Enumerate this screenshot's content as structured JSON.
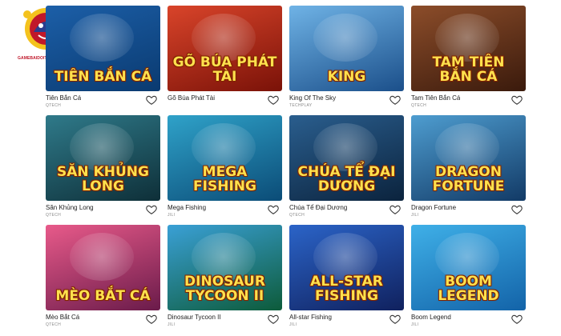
{
  "site": {
    "logo_text": "GAMEBAIDOITHUONG • VIETNAM",
    "accent": "#c0182a"
  },
  "games": [
    {
      "name": "Tiên Bắn Cá",
      "provider": "QTECH",
      "art": "TIÊN BẮN CÁ",
      "bg": [
        "#1c5fa8",
        "#0a3a70"
      ]
    },
    {
      "name": "Gõ Búa Phát Tài",
      "provider": "",
      "art": "GÕ BÚA PHÁT TÀI",
      "bg": [
        "#d9442a",
        "#7a1208"
      ]
    },
    {
      "name": "King Of The Sky",
      "provider": "TECHPLAY",
      "art": "KING",
      "bg": [
        "#6fb3e6",
        "#1b4f8a"
      ]
    },
    {
      "name": "Tam Tiên Bắn Cá",
      "provider": "QTECH",
      "art": "TAM TIÊN BẮN CÁ",
      "bg": [
        "#8c4d2a",
        "#3a1a0c"
      ]
    },
    {
      "name": "Săn Khủng Long",
      "provider": "QTECH",
      "art": "SĂN KHỦNG LONG",
      "bg": [
        "#2f7a8a",
        "#0e2f38"
      ]
    },
    {
      "name": "Mega Fishing",
      "provider": "JILI",
      "art": "Mega Fishing",
      "bg": [
        "#2fa2c9",
        "#0b4c77"
      ]
    },
    {
      "name": "Chúa Tể Đại Dương",
      "provider": "QTECH",
      "art": "CHÚA TỂ ĐẠI DƯƠNG",
      "bg": [
        "#2a5e8e",
        "#0b233d"
      ]
    },
    {
      "name": "Dragon Fortune",
      "provider": "JILI",
      "art": "Dragon Fortune",
      "bg": [
        "#4e9dd0",
        "#123a66"
      ]
    },
    {
      "name": "Mèo Bắt Cá",
      "provider": "QTECH",
      "art": "MÈO BẮT CÁ",
      "bg": [
        "#e85a8a",
        "#6a1b4a"
      ]
    },
    {
      "name": "Dinosaur Tycoon II",
      "provider": "JILI",
      "art": "Dinosaur Tycoon II",
      "bg": [
        "#3aa0d6",
        "#0d5b3a"
      ]
    },
    {
      "name": "All-star Fishing",
      "provider": "JILI",
      "art": "All-Star Fishing",
      "bg": [
        "#2b64c8",
        "#10215e"
      ]
    },
    {
      "name": "Boom Legend",
      "provider": "JILI",
      "art": "Boom Legend",
      "bg": [
        "#3fb0e8",
        "#1363a8"
      ]
    }
  ]
}
